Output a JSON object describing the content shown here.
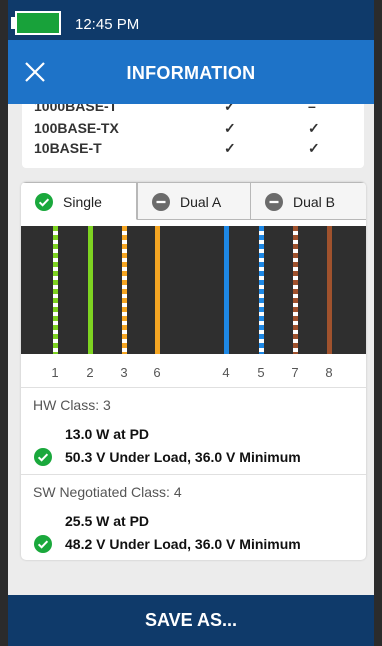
{
  "status_bar": {
    "time": "12:45 PM"
  },
  "header": {
    "title": "INFORMATION",
    "close_icon": "close-icon"
  },
  "speed_table": {
    "rows": [
      {
        "label": "1000BASE-T",
        "col1": "✓",
        "col2": "–"
      },
      {
        "label": "100BASE-TX",
        "col1": "✓",
        "col2": "✓"
      },
      {
        "label": "10BASE-T",
        "col1": "✓",
        "col2": "✓"
      }
    ]
  },
  "tabs": [
    {
      "label": "Single",
      "icon": "check-circle-icon",
      "active": true
    },
    {
      "label": "Dual A",
      "icon": "minus-circle-icon",
      "active": false
    },
    {
      "label": "Dual B",
      "icon": "minus-circle-icon",
      "active": false
    }
  ],
  "wires": [
    {
      "pin": "1",
      "color": "#7ed321",
      "striped": true
    },
    {
      "pin": "2",
      "color": "#7ed321",
      "striped": false
    },
    {
      "pin": "3",
      "color": "#f5a623",
      "striped": true
    },
    {
      "pin": "6",
      "color": "#f5a623",
      "striped": false
    },
    {
      "pin": "4",
      "color": "#1e88e5",
      "striped": false
    },
    {
      "pin": "5",
      "color": "#1e88e5",
      "striped": true
    },
    {
      "pin": "7",
      "color": "#a0522d",
      "striped": true
    },
    {
      "pin": "8",
      "color": "#a0522d",
      "striped": false
    }
  ],
  "hw_class": {
    "label": "HW Class: 3",
    "power": "13.0 W at PD",
    "voltage": "50.3 V Under Load, 36.0 V Minimum"
  },
  "sw_class": {
    "label": "SW Negotiated Class: 4",
    "power": "25.5 W at PD",
    "voltage": "48.2 V Under Load, 36.0 V Minimum"
  },
  "footer": {
    "save_label": "SAVE AS..."
  },
  "colors": {
    "status_bar": "#0f3a6a",
    "app_bar": "#1e73c8",
    "check_green": "#1aa83c",
    "neutral_gray": "#6b6b6b"
  }
}
